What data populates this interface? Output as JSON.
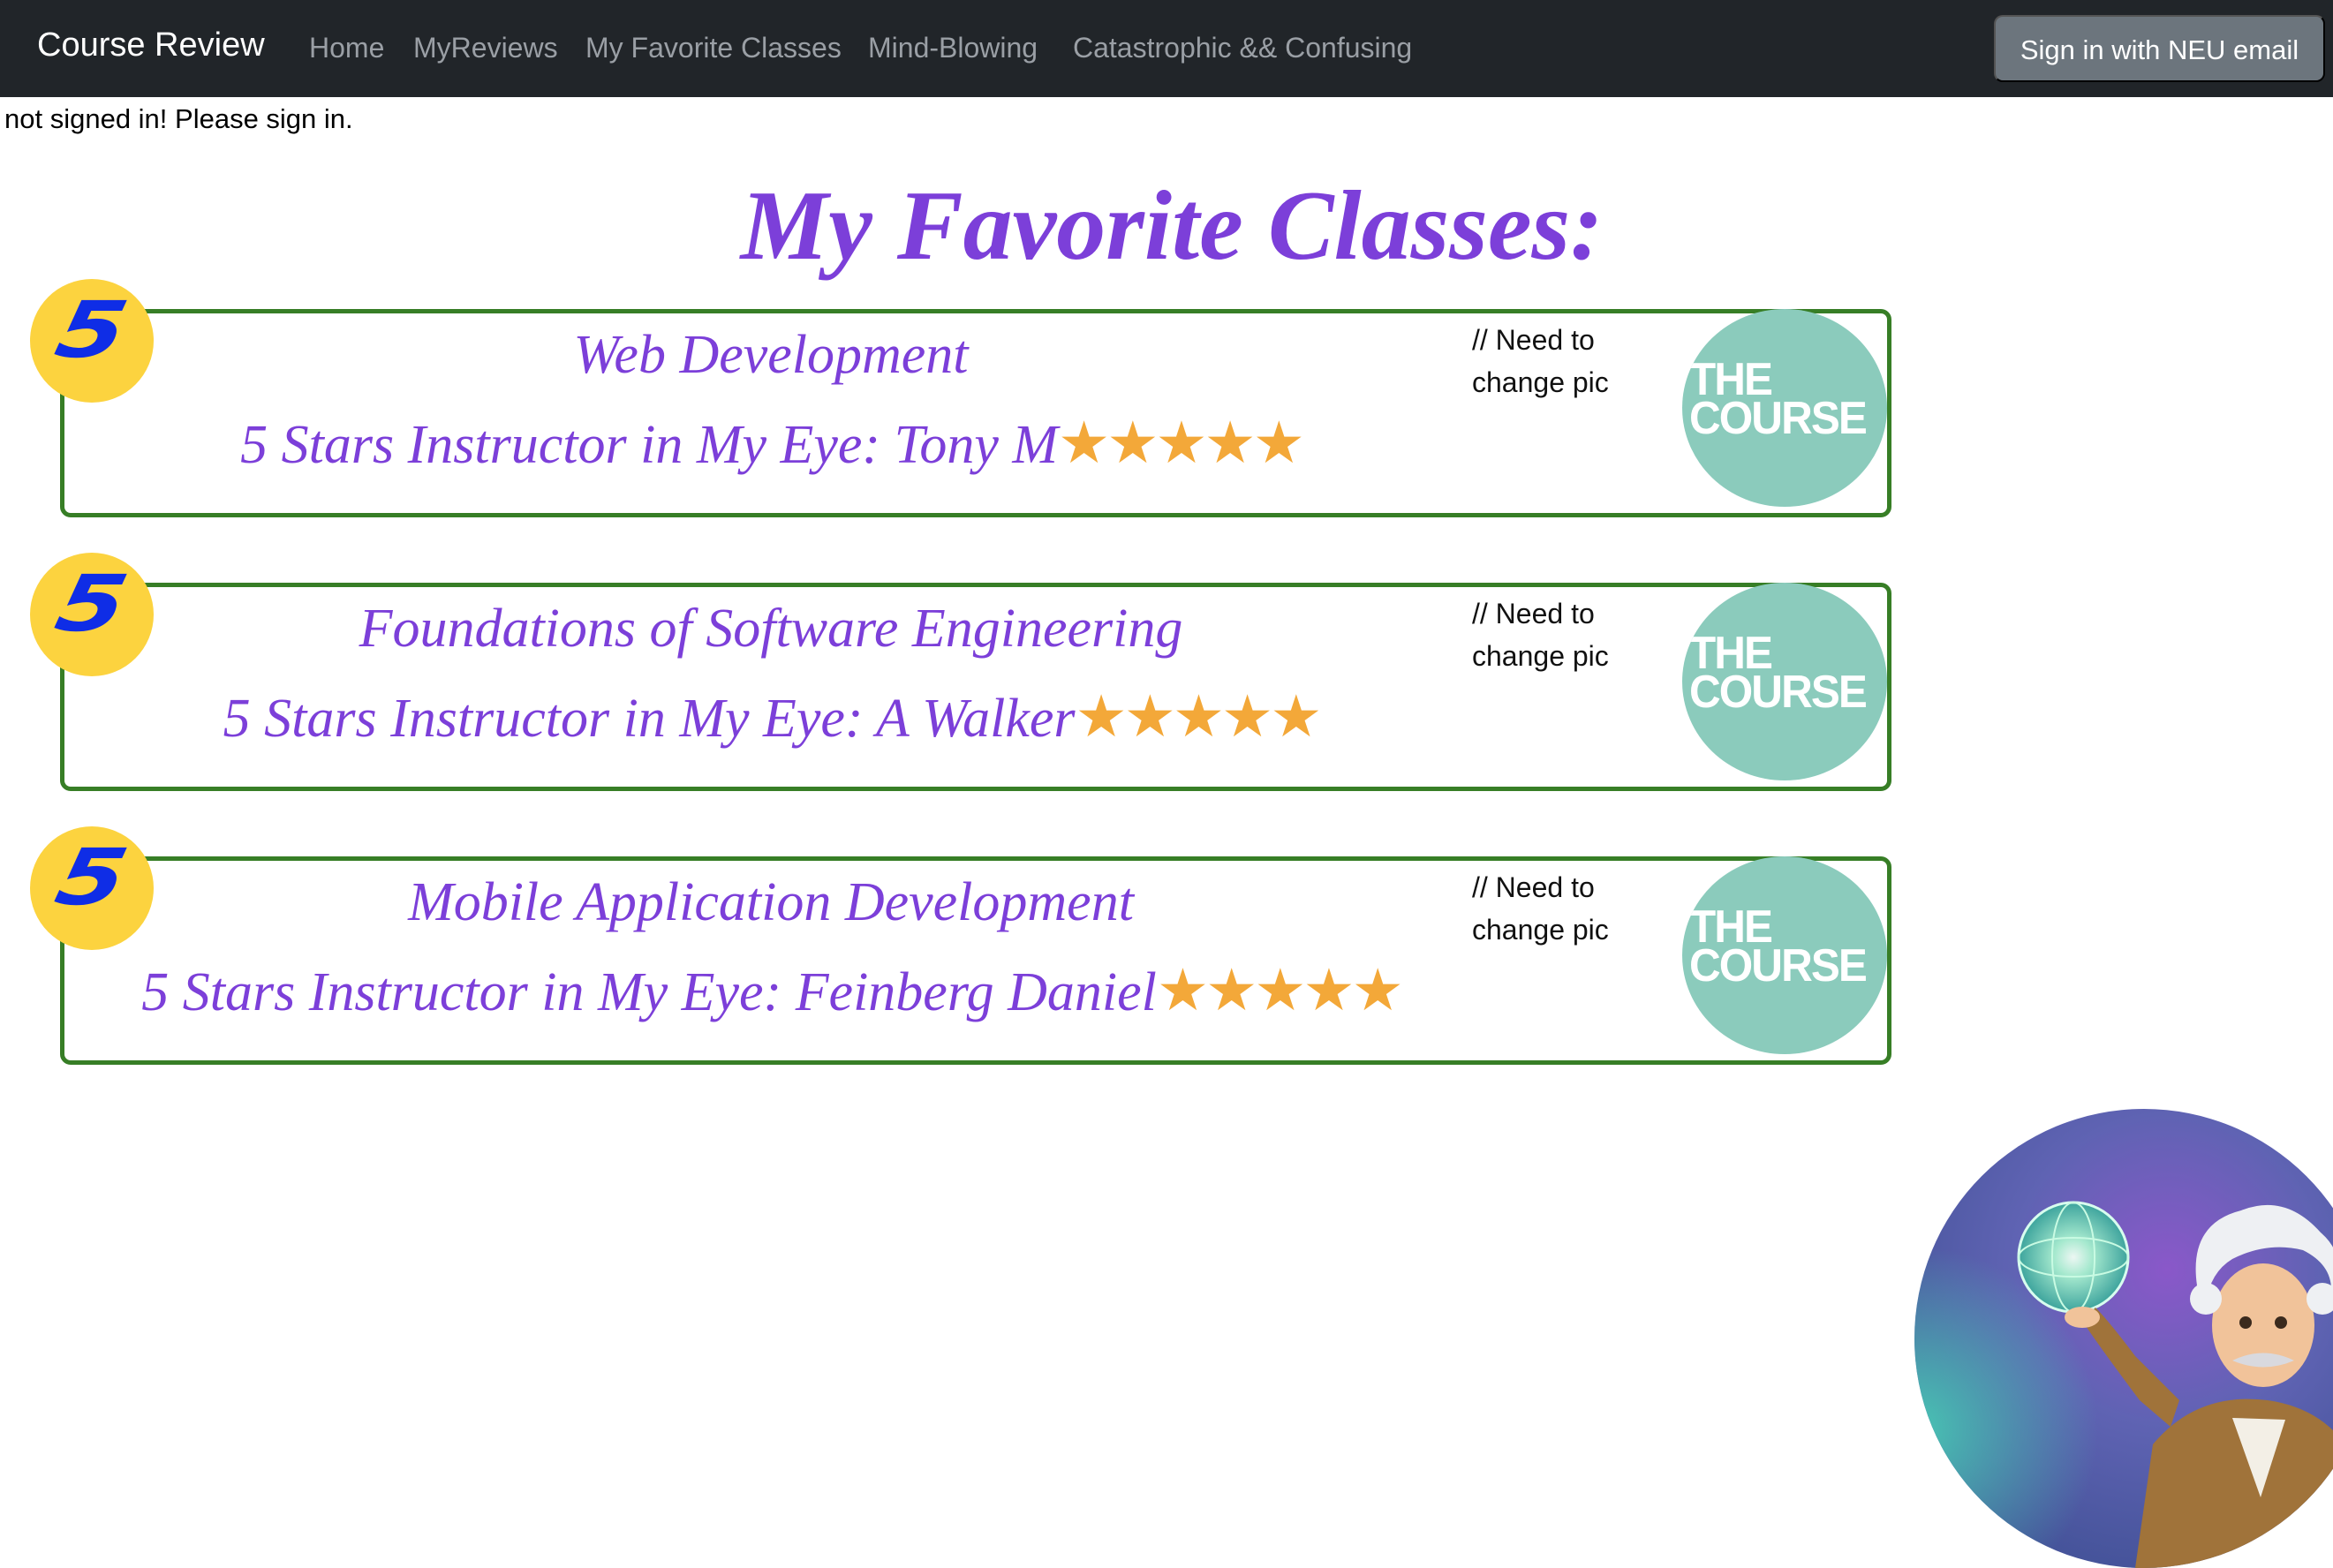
{
  "navbar": {
    "brand": "Course Review",
    "links": [
      {
        "label": "Home"
      },
      {
        "label": "MyReviews"
      },
      {
        "label": "My Favorite Classes"
      },
      {
        "label": "Mind-Blowing"
      },
      {
        "label": "Catastrophic && Confusing"
      }
    ],
    "signin_label": "Sign in with NEU email"
  },
  "status_text": "not signed in! Please sign in.",
  "page_title": "My Favorite Classes:",
  "courses": [
    {
      "rating": "5",
      "title": "Web Development",
      "instructor_prefix": "5 Stars Instructor in My Eye: ",
      "instructor": "Tony M",
      "stars": "★★★★★",
      "star_count": 5,
      "note": "// Need to change pic",
      "logo_text": "THE COURSE"
    },
    {
      "rating": "5",
      "title": "Foundations of Software Engineering",
      "instructor_prefix": "5 Stars Instructor in My Eye: ",
      "instructor": "A Walker",
      "stars": "★★★★★",
      "star_count": 5,
      "note": "// Need to change pic",
      "logo_text": "THE COURSE"
    },
    {
      "rating": "5",
      "title": "Mobile Application Development",
      "instructor_prefix": "5 Stars Instructor in My Eye: ",
      "instructor": "Feinberg Daniel",
      "stars": "★★★★★",
      "star_count": 5,
      "note": "// Need to change pic",
      "logo_text": "THE COURSE"
    }
  ],
  "colors": {
    "navbar_bg": "#212529",
    "title_purple": "#7c3fd9",
    "card_border": "#377e26",
    "badge_yellow": "#fcd33f",
    "badge_text": "#0f2de6",
    "star_orange": "#f3a839",
    "logo_teal": "#8bcbbc"
  }
}
